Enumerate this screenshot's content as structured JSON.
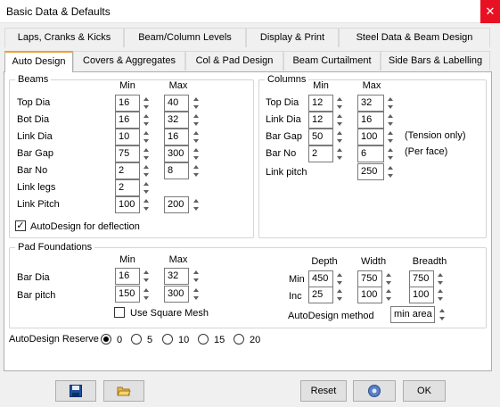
{
  "window": {
    "title": "Basic Data & Defaults",
    "close_glyph": "✕"
  },
  "tabs": {
    "row1": [
      "Laps, Cranks & Kicks",
      "Beam/Column Levels",
      "Display & Print",
      "Steel Data & Beam Design"
    ],
    "row2": [
      "Auto Design",
      "Covers & Aggregates",
      "Col & Pad Design",
      "Beam Curtailment",
      "Side Bars & Labelling"
    ],
    "active": "Auto Design"
  },
  "beams": {
    "title": "Beams",
    "min_header": "Min",
    "max_header": "Max",
    "rows": [
      {
        "label": "Top Dia",
        "min": "16",
        "max": "40"
      },
      {
        "label": "Bot Dia",
        "min": "16",
        "max": "32"
      },
      {
        "label": "Link Dia",
        "min": "10",
        "max": "16"
      },
      {
        "label": "Bar Gap",
        "min": "75",
        "max": "300"
      },
      {
        "label": "Bar No",
        "min": "2",
        "max": "8"
      },
      {
        "label": "Link legs",
        "min": "2",
        "max": ""
      },
      {
        "label": "Link Pitch",
        "min": "100",
        "max": "200"
      }
    ],
    "autodesign_label": "AutoDesign for deflection",
    "autodesign_checked": true,
    "check_glyph": "✓"
  },
  "columns": {
    "title": "Columns",
    "min_header": "Min",
    "max_header": "Max",
    "rows": [
      {
        "label": "Top Dia",
        "min": "12",
        "max": "32"
      },
      {
        "label": "Link Dia",
        "min": "12",
        "max": "16"
      },
      {
        "label": "Bar Gap",
        "min": "50",
        "max": "100"
      },
      {
        "label": "Bar No",
        "min": "2",
        "max": "6"
      },
      {
        "label": "Link pitch",
        "min": "",
        "max": "250"
      }
    ],
    "note_tension": "(Tension only)",
    "note_face": "(Per face)"
  },
  "pad": {
    "title": "Pad Foundations",
    "min_header": "Min",
    "max_header": "Max",
    "rows": [
      {
        "label": "Bar Dia",
        "min": "16",
        "max": "32"
      },
      {
        "label": "Bar pitch",
        "min": "150",
        "max": "300"
      }
    ],
    "square_mesh_label": "Use Square Mesh",
    "square_mesh_checked": false,
    "dim_headers": {
      "depth": "Depth",
      "width": "Width",
      "breadth": "Breadth"
    },
    "min_label": "Min",
    "inc_label": "Inc",
    "min_values": {
      "depth": "450",
      "width": "750",
      "breadth": "750"
    },
    "inc_values": {
      "depth": "25",
      "width": "100",
      "breadth": "100"
    },
    "method_label": "AutoDesign method",
    "method_value": "min area"
  },
  "reserve": {
    "label": "AutoDesign Reserve",
    "options": [
      "0",
      "5",
      "10",
      "15",
      "20"
    ],
    "selected": "0"
  },
  "buttons": {
    "save_icon": "save-icon",
    "open_icon": "open-folder-icon",
    "reset": "Reset",
    "help_icon": "help-icon",
    "ok": "OK"
  },
  "colors": {
    "close": "#e81123",
    "active_tab_accent": "#f0a030",
    "save_icon": "#1f4e9c",
    "folder_icon": "#e8b84a"
  }
}
